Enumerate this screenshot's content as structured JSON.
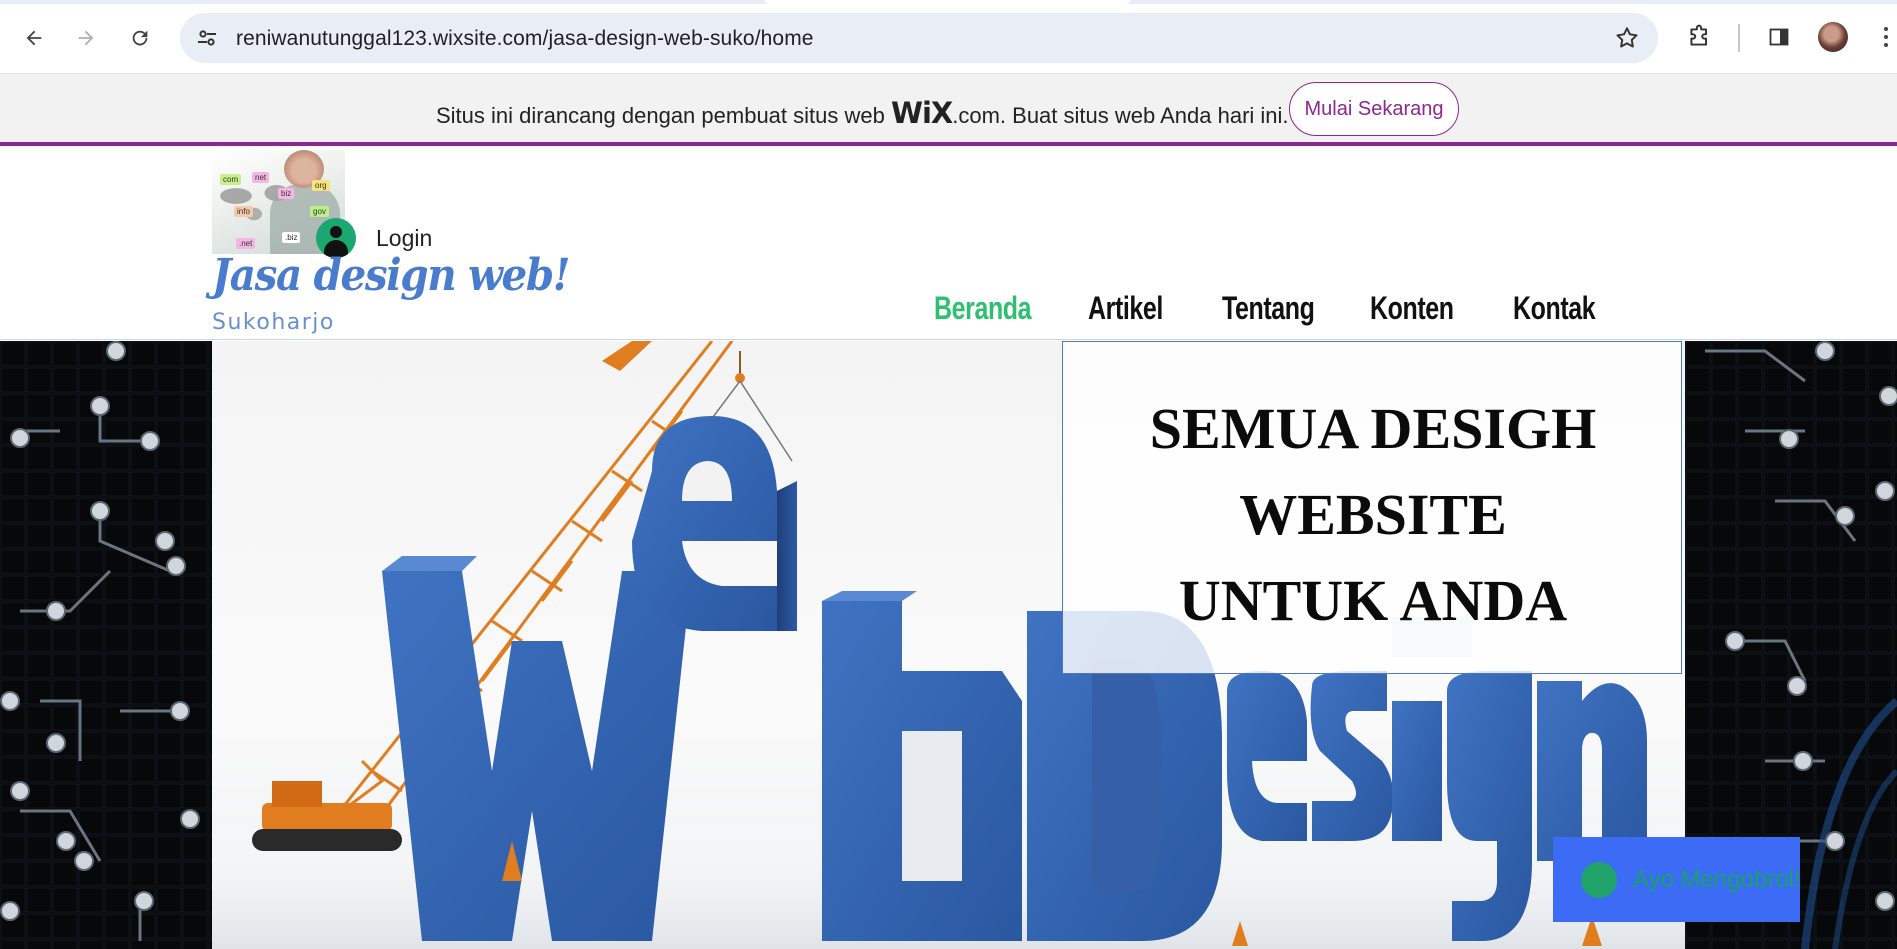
{
  "browser": {
    "url": "reniwanutunggal123.wixsite.com/jasa-design-web-suko/home"
  },
  "wix_banner": {
    "text_before": "Situs ini dirancang dengan pembuat situs web ",
    "wix_logo": "WiX",
    "text_after": ".com. Buat situs web Anda hari ini.",
    "cta_label": "Mulai Sekarang"
  },
  "header": {
    "login_label": "Login",
    "site_title": "Jasa design web!",
    "site_subtitle": "Sukoharjo",
    "logo_tags": [
      "com",
      "net",
      "biz",
      "org",
      "info",
      "gov",
      ".biz",
      ".net"
    ],
    "nav": [
      {
        "label": "Beranda",
        "active": true
      },
      {
        "label": "Artikel",
        "active": false
      },
      {
        "label": "Tentang",
        "active": false
      },
      {
        "label": "Konten",
        "active": false
      },
      {
        "label": "Kontak",
        "active": false
      }
    ]
  },
  "hero": {
    "headline": [
      "SEMUA DESIGH",
      "WEBSITE",
      "UNTUK ANDA"
    ],
    "image_word_1": "web",
    "image_word_2": "Design"
  },
  "chat": {
    "label": "Ayo Mengobrol!"
  },
  "colors": {
    "wix_purple": "#8e278f",
    "nav_active": "#2fbf71",
    "title_blue": "#4a7ccd",
    "chat_blue": "#3c6cf5",
    "chat_green": "#1fa36b",
    "letter_blue": "#2f5fa8"
  }
}
